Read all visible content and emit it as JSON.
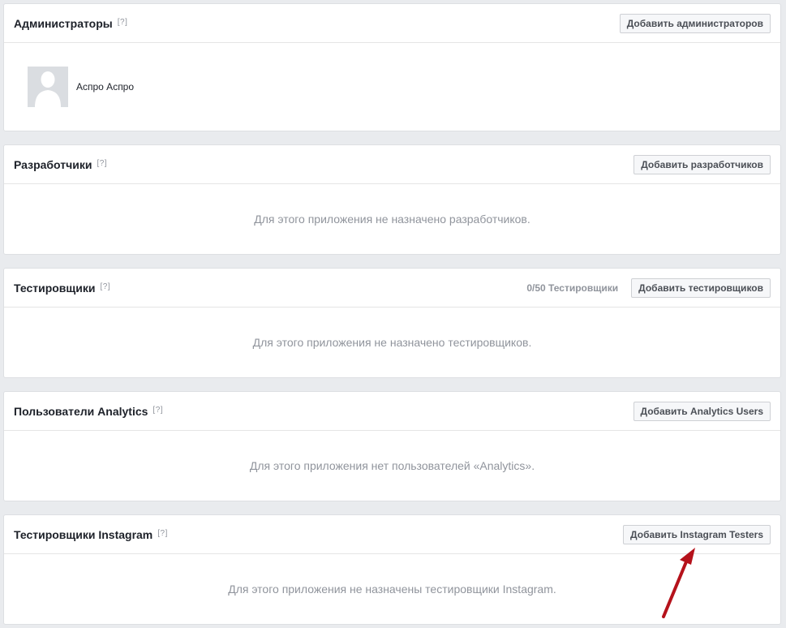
{
  "sections": {
    "admins": {
      "title": "Администраторы",
      "help": "[?]",
      "button": "Добавить администраторов",
      "members": [
        {
          "name": "Аспро Аспро"
        }
      ]
    },
    "developers": {
      "title": "Разработчики",
      "help": "[?]",
      "button": "Добавить разработчиков",
      "empty_text": "Для этого приложения не назначено разработчиков."
    },
    "testers": {
      "title": "Тестировщики",
      "help": "[?]",
      "count": "0/50 Тестировщики",
      "button": "Добавить тестировщиков",
      "empty_text": "Для этого приложения не назначено тестировщиков."
    },
    "analytics": {
      "title": "Пользователи Analytics",
      "help": "[?]",
      "button": "Добавить Analytics Users",
      "empty_text": "Для этого приложения нет пользователей «Analytics»."
    },
    "instagram": {
      "title": "Тестировщики Instagram",
      "help": "[?]",
      "button": "Добавить Instagram Testers",
      "empty_text": "Для этого приложения не назначены тестировщики Instagram."
    }
  },
  "annotation": {
    "arrow_color": "#b5121b",
    "target": "add-instagram-testers-button"
  },
  "colors": {
    "page_bg": "#e9ebee",
    "panel_border": "#dddfe2",
    "muted_text": "#90949c",
    "button_bg": "#f6f7f9"
  }
}
